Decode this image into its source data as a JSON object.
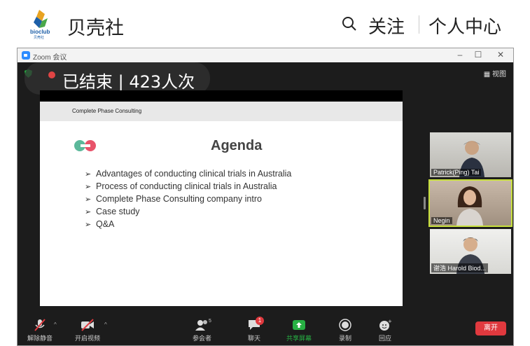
{
  "appbar": {
    "brand_text": "bioclub",
    "brand_sub": "贝壳社",
    "title": "贝壳社",
    "follow_label": "关注",
    "profile_label": "个人中心"
  },
  "zoom": {
    "window_title": "Zoom 会议",
    "minimize": "–",
    "maximize": "☐",
    "close": "✕",
    "view_label": "▦ 视图",
    "live_text": "已结束 | 423人次"
  },
  "slide": {
    "brand": "Complete Phase Consulting",
    "title": "Agenda",
    "items": [
      "Advantages of conducting clinical trials in Australia",
      "Process of conducting clinical trials in Australia",
      "Complete Phase Consulting company intro",
      "Case study",
      "Q&A"
    ]
  },
  "participants": [
    {
      "name": "Patrick(Ping) Tai"
    },
    {
      "name": "Negin"
    },
    {
      "name": "谢浩 Harold Biod..."
    }
  ],
  "toolbar": {
    "unmute_label": "解除静音",
    "video_label": "开启视频",
    "participants_label": "参会者",
    "participants_count": "5",
    "chat_label": "聊天",
    "chat_badge": "1",
    "share_label": "共享屏幕",
    "record_label": "录制",
    "reactions_label": "回应",
    "leave_label": "离开"
  },
  "colors": {
    "share_green": "#27b043",
    "leave_red": "#e0393e",
    "active_speaker": "#c8e03c",
    "brand_blue": "#1d5fa8"
  }
}
